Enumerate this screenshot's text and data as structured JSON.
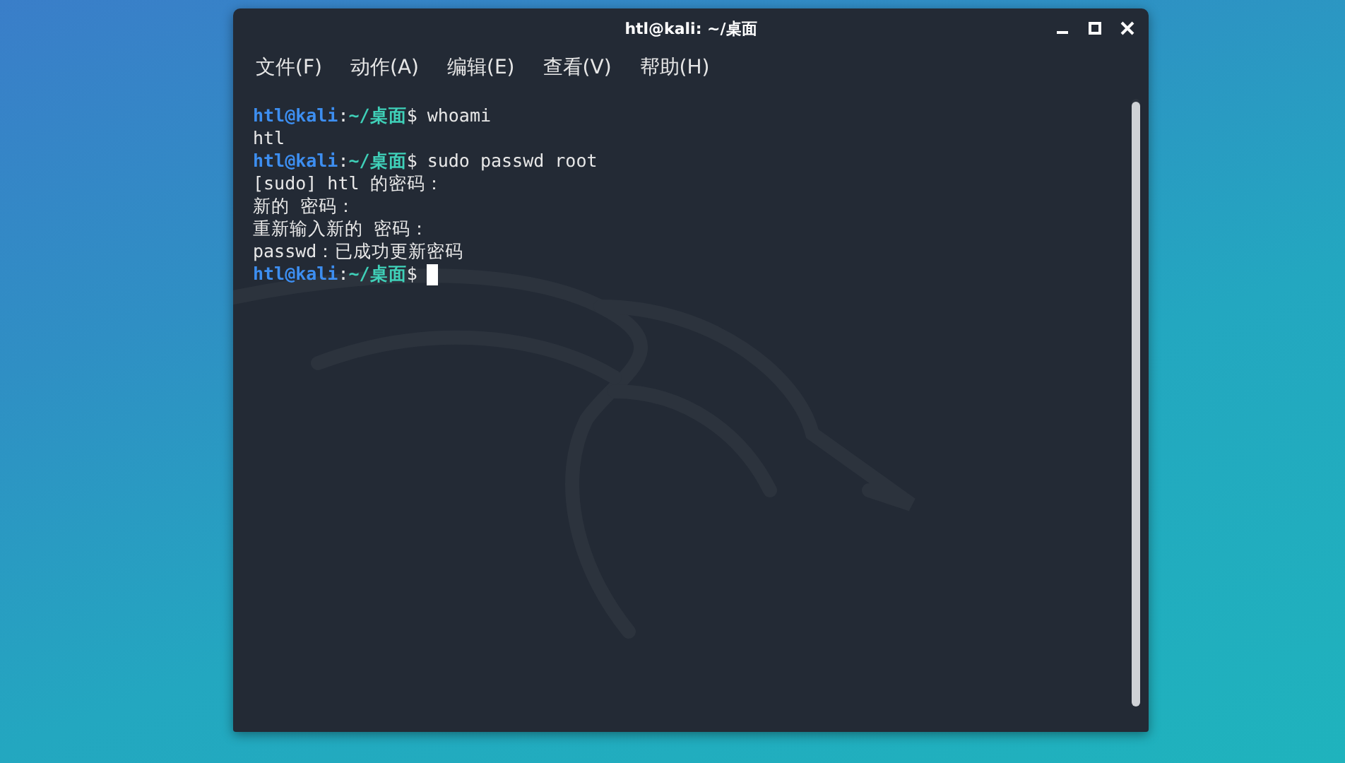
{
  "window": {
    "title": "htl@kali: ~/桌面"
  },
  "menu": [
    {
      "label": "文件(F)"
    },
    {
      "label": "动作(A)"
    },
    {
      "label": "编辑(E)"
    },
    {
      "label": "查看(V)"
    },
    {
      "label": "帮助(H)"
    }
  ],
  "terminal": {
    "lines": [
      {
        "kind": "prompt",
        "user": "htl@kali",
        "sep": ":",
        "path": "~/桌面",
        "symbol": "$",
        "command": "whoami",
        "cursor": false
      },
      {
        "kind": "output",
        "text": "htl"
      },
      {
        "kind": "prompt",
        "user": "htl@kali",
        "sep": ":",
        "path": "~/桌面",
        "symbol": "$",
        "command": "sudo passwd root",
        "cursor": false
      },
      {
        "kind": "output",
        "text": "[sudo] htl 的密码："
      },
      {
        "kind": "output",
        "text": "新的 密码："
      },
      {
        "kind": "output",
        "text": "重新输入新的 密码："
      },
      {
        "kind": "output",
        "text": "passwd：已成功更新密码"
      },
      {
        "kind": "prompt",
        "user": "htl@kali",
        "sep": ":",
        "path": "~/桌面",
        "symbol": "$",
        "cursor": true
      }
    ]
  }
}
